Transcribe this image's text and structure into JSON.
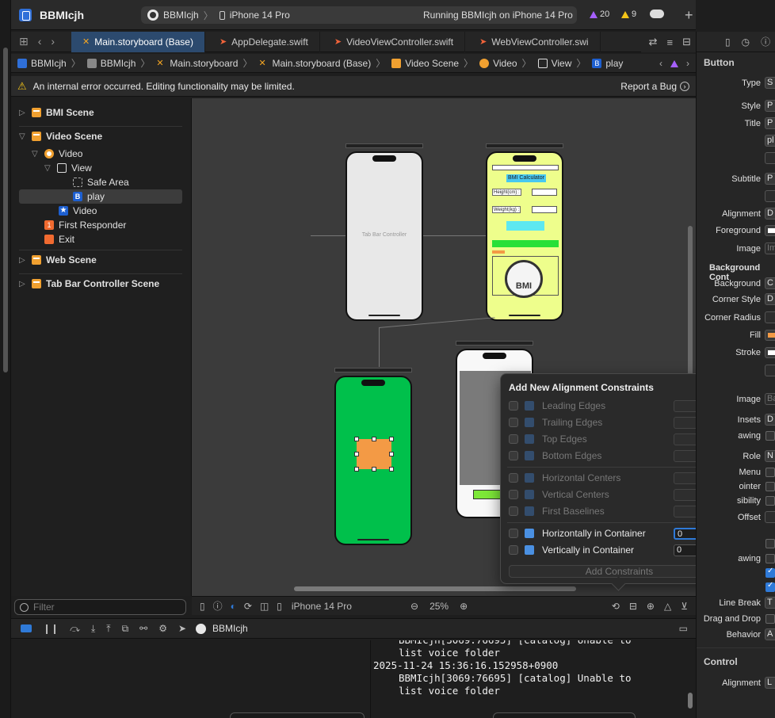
{
  "titlebar": {
    "app_name": "BBMIcjh",
    "scheme": "BBMIcjh",
    "device": "iPhone 14 Pro",
    "status": "Running BBMIcjh on iPhone 14 Pro",
    "purple_warnings": "20",
    "yellow_warnings": "9"
  },
  "tabs": [
    {
      "label": "Main.storyboard (Base)",
      "icon": "storyboard-icon",
      "active": true
    },
    {
      "label": "AppDelegate.swift",
      "icon": "swift-icon",
      "active": false
    },
    {
      "label": "VideoViewController.swift",
      "icon": "swift-icon",
      "active": false
    },
    {
      "label": "WebViewController.swi",
      "icon": "swift-icon",
      "active": false
    }
  ],
  "breadcrumb": [
    {
      "label": "BBMIcjh",
      "icon": "project-icon"
    },
    {
      "label": "BBMIcjh",
      "icon": "folder-icon"
    },
    {
      "label": "Main.storyboard",
      "icon": "storyboard-icon"
    },
    {
      "label": "Main.storyboard (Base)",
      "icon": "storyboard-icon"
    },
    {
      "label": "Video Scene",
      "icon": "scene-icon"
    },
    {
      "label": "Video",
      "icon": "view-controller-icon"
    },
    {
      "label": "View",
      "icon": "view-icon"
    },
    {
      "label": "play",
      "icon": "button-icon"
    }
  ],
  "error": {
    "message": "An internal error occurred. Editing functionality may be limited.",
    "report": "Report a Bug"
  },
  "outline": {
    "items": [
      {
        "label": "BMI Scene"
      },
      {
        "label": "Video Scene"
      },
      {
        "label": "Video"
      },
      {
        "label": "View"
      },
      {
        "label": "Safe Area"
      },
      {
        "label": "play"
      },
      {
        "label": "Video"
      },
      {
        "label": "First Responder"
      },
      {
        "label": "Exit"
      },
      {
        "label": "Web Scene"
      },
      {
        "label": "Tab Bar Controller Scene"
      }
    ],
    "filter_placeholder": "Filter"
  },
  "canvas": {
    "tab_bar_controller_label": "Tab Bar Controller",
    "bmi_title": "BMI Calculator",
    "height_label": "Height(cm) :",
    "weight_label": "Weight(kg) :",
    "gauge_label": "BMI"
  },
  "popover": {
    "title": "Add New Alignment Constraints",
    "rows": [
      {
        "label": "Leading Edges",
        "value": ""
      },
      {
        "label": "Trailing Edges",
        "value": ""
      },
      {
        "label": "Top Edges",
        "value": ""
      },
      {
        "label": "Bottom Edges",
        "value": ""
      },
      {
        "label": "Horizontal Centers",
        "value": ""
      },
      {
        "label": "Vertical Centers",
        "value": ""
      },
      {
        "label": "First Baselines",
        "value": ""
      },
      {
        "label": "Horizontally in Container",
        "value": "0"
      },
      {
        "label": "Vertically in Container",
        "value": "0"
      }
    ],
    "add_button": "Add Constraints"
  },
  "canvas_toolbar": {
    "device": "iPhone 14 Pro",
    "zoom": "25%"
  },
  "debug": {
    "process": "BBMIcjh"
  },
  "console": {
    "line0": "BBMIcjh[3069:76695] [catalog] Unable to",
    "line1": "list voice folder",
    "line2": "2025-11-24 15:36:16.152958+0900",
    "line3": "BBMIcjh[3069:76695] [catalog] Unable to",
    "line4": "list voice folder"
  },
  "inspector": {
    "section_button": "Button",
    "type": "Type",
    "type_value": "S",
    "style": "Style",
    "style_value": "P",
    "title": "Title",
    "title_value": "P",
    "title_text": "pl",
    "subtitle": "Subtitle",
    "subtitle_value": "P",
    "alignment": "Alignment",
    "alignment_value": "D",
    "foreground": "Foreground",
    "image": "Image",
    "image_placeholder": "Im",
    "background_config": "Background Cont",
    "background": "Background",
    "background_value": "C",
    "corner_style": "Corner Style",
    "corner_style_value": "D",
    "corner_radius": "Corner Radius",
    "fill": "Fill",
    "stroke": "Stroke",
    "image2": "Image",
    "image2_placeholder": "Ba",
    "insets": "Insets",
    "insets_value": "D",
    "drawing": "awing",
    "role": "Role",
    "role_value": "N",
    "menu": "Menu",
    "pointer": "ointer",
    "visibility": "sibility",
    "offset": "Offset",
    "drawing2": "awing",
    "line_break": "Line Break",
    "line_break_value": "T",
    "drag_drop": "Drag and Drop",
    "behavior": "Behavior",
    "behavior_value": "A",
    "section_control": "Control",
    "control_alignment": "Alignment",
    "control_alignment_value": "L"
  },
  "colors": {
    "accent": "#2f7ad8",
    "canvas": "#3b3b3b",
    "green_scene": "#00c04b",
    "bmi_scene": "#eefe8c",
    "play_button": "#f39a45"
  }
}
